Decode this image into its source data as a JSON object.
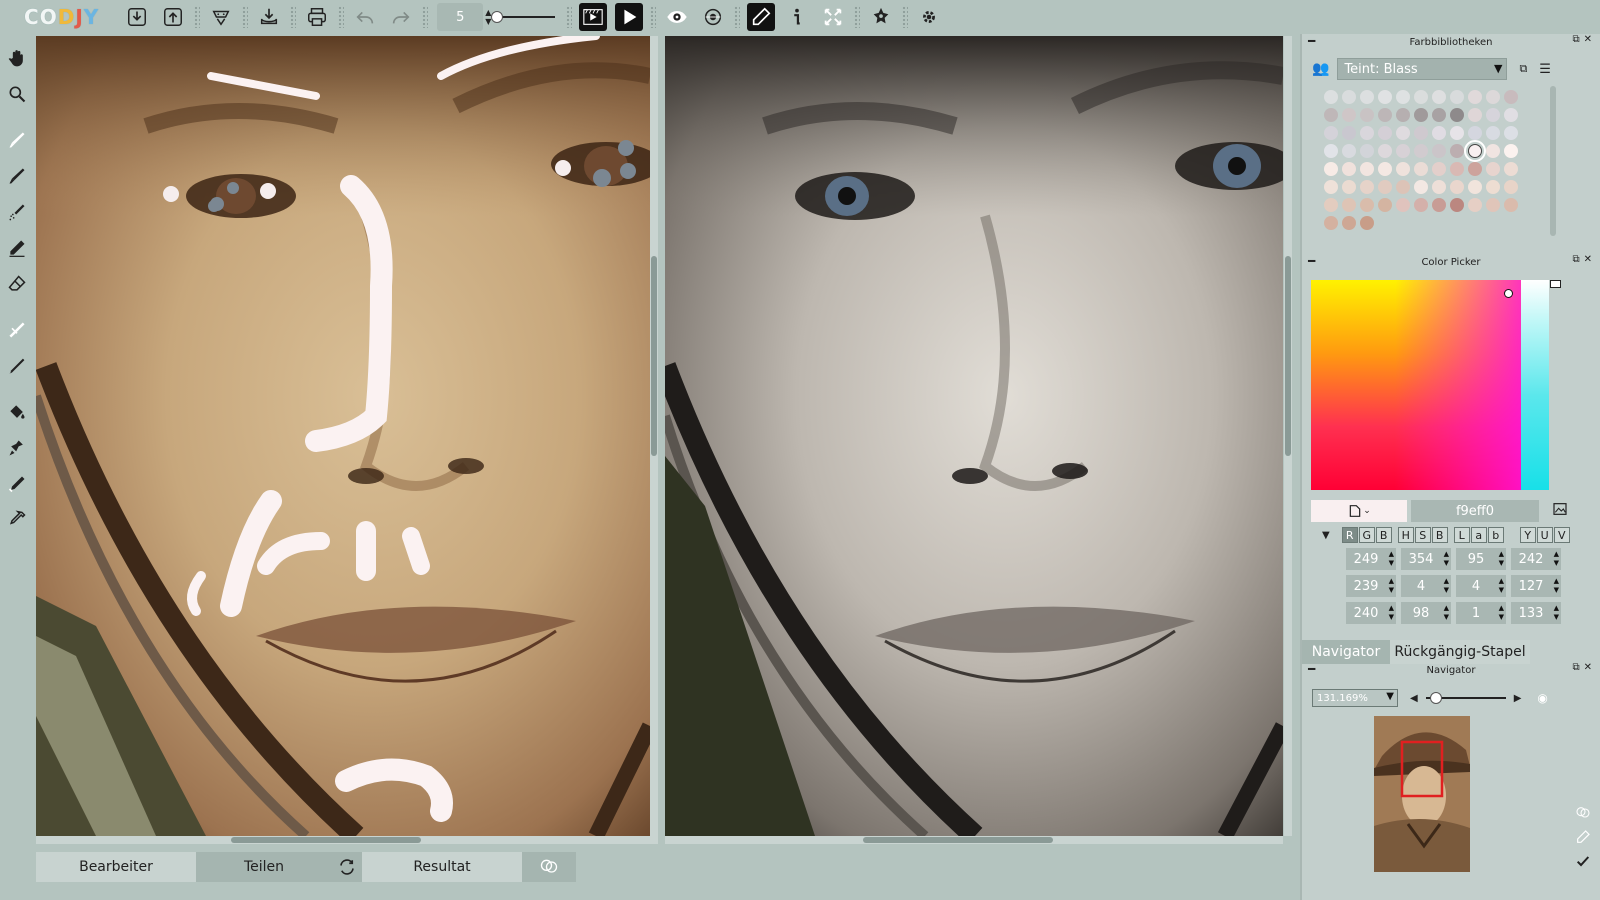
{
  "app": {
    "logo": {
      "c1": "C",
      "c2": "O",
      "c3": "D",
      "c4": "J",
      "c5": "Y",
      "prefix": "CO",
      "mid": "DJY"
    }
  },
  "toolbar": {
    "brush_size": "5",
    "tools": [
      "import-icon",
      "export-icon",
      "palette-icon",
      "download-icon",
      "print-icon",
      "undo-icon",
      "redo-icon",
      "film-icon",
      "play-icon",
      "eye-icon",
      "mask-icon",
      "pen-icon",
      "info-icon",
      "expand-icon",
      "settings-icon",
      "gear-icon"
    ]
  },
  "tabs": {
    "edit": "Bearbeiter",
    "share": "Teilen",
    "result": "Resultat"
  },
  "library": {
    "title": "Farbbibliotheken",
    "selected": "Teint: Blass",
    "swatches": [
      "#dcdfe0",
      "#d9dcdd",
      "#dcdfe0",
      "#e0e2e3",
      "#dee1e2",
      "#dadddd",
      "#dedfe0",
      "#d8dbdc",
      "#e0d9da",
      "#dcd8d9",
      "#c8bbbd",
      "#bfb7b8",
      "#cfc6c7",
      "#c9c3c4",
      "#bdb6b7",
      "#b6afb0",
      "#a09a9b",
      "#a8a2a3",
      "#8e8a8b",
      "#dfd6d7",
      "#d6d4db",
      "#e0dee3",
      "#d4d2d9",
      "#c9c7cf",
      "#d9d6dc",
      "#d4cfd6",
      "#dfdbdf",
      "#cfc9cf",
      "#e0dce3",
      "#e6e3e8",
      "#d4d6df",
      "#d8dbe2",
      "#dcdfe5",
      "#e1e3e8",
      "#d8dadf",
      "#d2d4d9",
      "#ddd8dc",
      "#d7d1d6",
      "#d1cbcf",
      "#cbc5c9",
      "#bcaeb0",
      "#f9eff0",
      "#f0e4e1",
      "#fbf2ef",
      "#f7ebe6",
      "#f0e1dc",
      "#f2e5e0",
      "#f4e8e3",
      "#efe2dc",
      "#eadcd6",
      "#e3cfcb",
      "#d9b9b4",
      "#cda39c",
      "#e7d4ce",
      "#ecdcd4",
      "#efe1d9",
      "#ebdbd1",
      "#e6d3c9",
      "#e1cbc0",
      "#dcc3b7",
      "#f3e8e3",
      "#eedfd8",
      "#e9d6cd",
      "#f1e4dc",
      "#edddd2",
      "#e8d4c8",
      "#e3ccbf",
      "#dec4b5",
      "#d9bcab",
      "#d4b4a1",
      "#e0c3bd",
      "#d4b0aa",
      "#c89c95",
      "#bb8780",
      "#e6cfc5",
      "#e0c5b9",
      "#dabbac",
      "#d4b1a0",
      "#cea794",
      "#c89d88"
    ],
    "selected_index": 41
  },
  "picker": {
    "title": "Color Picker",
    "hex": "f9eff0",
    "modes": [
      "R",
      "G",
      "B",
      "H",
      "S",
      "B",
      "L",
      "a",
      "b",
      "Y",
      "U",
      "V"
    ],
    "values": [
      [
        "249",
        "354",
        "95",
        "242"
      ],
      [
        "239",
        "4",
        "4",
        "127"
      ],
      [
        "240",
        "98",
        "1",
        "133"
      ]
    ]
  },
  "navigator": {
    "tab1": "Navigator",
    "tab2": "Rückgängig-Stapel",
    "title": "Navigator",
    "zoom": "131.169%"
  },
  "colors": {
    "panel": "#c3cfcc",
    "selected_color": "#f9eff0",
    "accent_red": "#e02020"
  }
}
